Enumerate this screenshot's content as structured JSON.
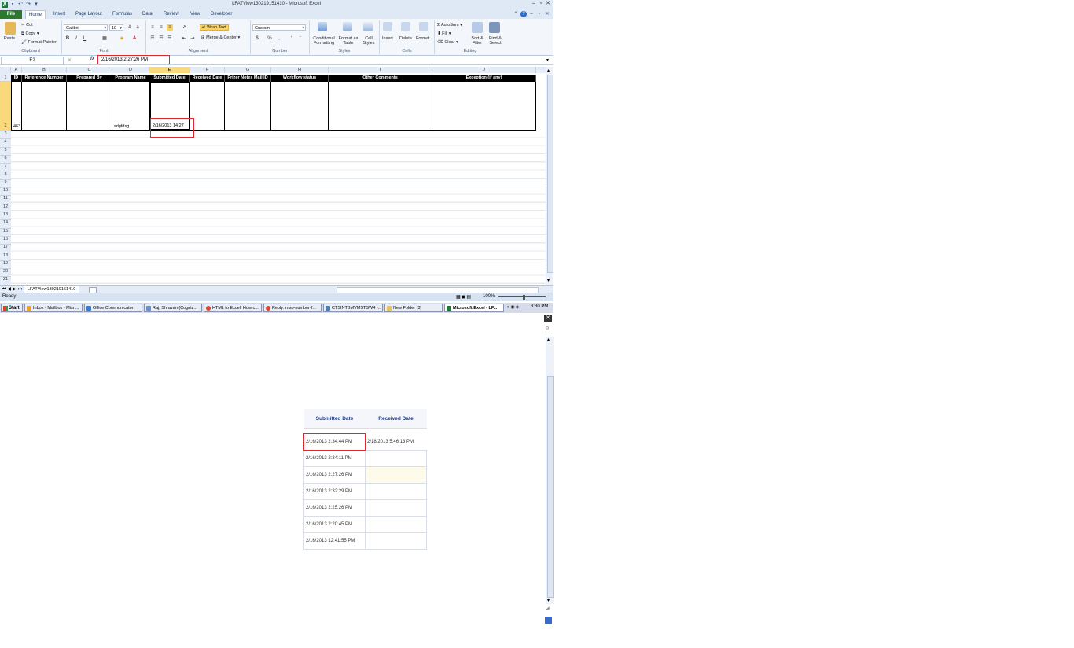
{
  "window": {
    "title": "LFATView130219151410 - Microsoft Excel"
  },
  "tabs": [
    "File",
    "Home",
    "Insert",
    "Page Layout",
    "Formulas",
    "Data",
    "Review",
    "View",
    "Developer"
  ],
  "ribbon": {
    "clipboard": {
      "label": "Clipboard",
      "paste": "Paste",
      "cut": "Cut",
      "copy": "Copy",
      "format_painter": "Format Painter"
    },
    "font": {
      "label": "Font",
      "name": "Calibri",
      "size": "10",
      "bold": "B",
      "italic": "I",
      "underline": "U"
    },
    "alignment": {
      "label": "Alignment",
      "wrap_text": "Wrap Text",
      "merge_center": "Merge & Center"
    },
    "number": {
      "label": "Number",
      "format": "Custom",
      "currency": "$",
      "percent": "%",
      "comma": ","
    },
    "styles": {
      "label": "Styles",
      "conditional": "Conditional Formatting",
      "format_table": "Format as Table",
      "cell_styles": "Cell Styles"
    },
    "cells": {
      "label": "Cells",
      "insert": "Insert",
      "delete": "Delete",
      "format": "Format"
    },
    "editing": {
      "label": "Editing",
      "autosum": "AutoSum",
      "fill": "Fill",
      "clear": "Clear",
      "sort_filter": "Sort & Filter",
      "find_select": "Find & Select"
    }
  },
  "formula_bar": {
    "cell_ref": "E2",
    "fx": "fx",
    "value": "2/16/2013  2:27:26 PM"
  },
  "columns": [
    "A",
    "B",
    "C",
    "D",
    "E",
    "F",
    "G",
    "H",
    "I",
    "J"
  ],
  "rows": [
    "1",
    "2",
    "3",
    "4",
    "5",
    "6",
    "7",
    "8",
    "9",
    "10",
    "11",
    "12",
    "13",
    "14",
    "15",
    "16",
    "17",
    "18",
    "19",
    "20",
    "21"
  ],
  "sheet": {
    "headers": [
      "ID",
      "Reference Number",
      "Prepared By",
      "Program Name",
      "Submitted Date",
      "Received Date",
      "Prizer Notes Mail ID",
      "Workflow status",
      "Other Comments",
      "Exception (if any)"
    ],
    "row2": {
      "id": "463",
      "program_name": "sdgfdsg",
      "submitted_date": "2/16/2013 14:27"
    }
  },
  "sheet_tab": "LFATView130219151410",
  "status": {
    "ready": "Ready",
    "zoom": "100%"
  },
  "taskbar": {
    "start": "Start",
    "items": [
      "Inbox - Mailbox - Misri...",
      "Office Communicator",
      "Raj, Shravan (Cogniz...",
      "HTML to Excel: How c...",
      "Reply: mso-number-f...",
      "CTSINTBMVMSTSW4 -...",
      "New Folder (3)",
      "Microsoft Excel - LF..."
    ],
    "clock": "3:30 PM"
  },
  "web_table": {
    "headers": [
      "Submitted Date",
      "Received Date"
    ],
    "rows": [
      {
        "submitted": "2/16/2013 2:34:44 PM",
        "received": "2/18/2013 5:46:13 PM"
      },
      {
        "submitted": "2/16/2013 2:34:11 PM",
        "received": ""
      },
      {
        "submitted": "2/16/2013 2:27:26 PM",
        "received": ""
      },
      {
        "submitted": "2/16/2013 2:32:29 PM",
        "received": ""
      },
      {
        "submitted": "2/16/2013 2:25:26 PM",
        "received": ""
      },
      {
        "submitted": "2/16/2013 2:20:45 PM",
        "received": ""
      },
      {
        "submitted": "2/16/2013 12:41:55 PM",
        "received": ""
      }
    ]
  },
  "colors": {
    "accent": "#2b7a2b",
    "highlight": "#e0262e",
    "selected_header": "#f9d97a",
    "link_blue": "#1f3c88"
  }
}
